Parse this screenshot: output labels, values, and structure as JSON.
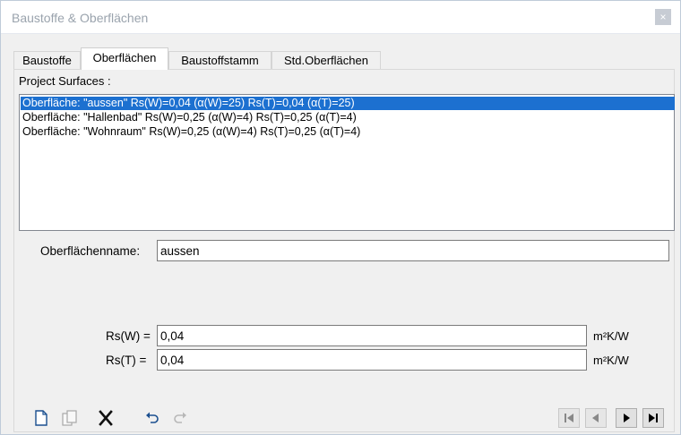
{
  "window": {
    "title": "Baustoffe & Oberflächen",
    "close_glyph": "×"
  },
  "tabs": [
    {
      "label": "Baustoffe"
    },
    {
      "label": "Oberflächen"
    },
    {
      "label": "Baustoffstamm"
    },
    {
      "label": "Std.Oberflächen"
    }
  ],
  "active_tab": "Oberflächen",
  "surfaces": {
    "label": "Project Surfaces :",
    "items": [
      {
        "text": "Oberfläche: \"aussen\"  Rs(W)=0,04  (α(W)=25)  Rs(T)=0,04  (α(T)=25)",
        "selected": true
      },
      {
        "text": "Oberfläche: \"Hallenbad\"  Rs(W)=0,25  (α(W)=4)  Rs(T)=0,25  (α(T)=4)",
        "selected": false
      },
      {
        "text": "Oberfläche: \"Wohnraum\"  Rs(W)=0,25  (α(W)=4)  Rs(T)=0,25  (α(T)=4)",
        "selected": false
      }
    ]
  },
  "form": {
    "name_label": "Oberflächenname:",
    "name_value": "aussen",
    "rsw_label": "Rs(W) =",
    "rsw_value": "0,04",
    "rst_label": "Rs(T) =",
    "rst_value": "0,04",
    "unit": "m²K/W"
  },
  "toolbar": {
    "buttons": [
      "new-icon",
      "copy-icon",
      "delete-icon",
      "undo-icon",
      "redo-icon"
    ]
  },
  "navigation": {
    "buttons": [
      "first-icon",
      "previous-icon",
      "next-icon",
      "last-icon"
    ]
  },
  "colors": {
    "selection": "#1c70d0",
    "title_text": "#9aa3ad"
  }
}
